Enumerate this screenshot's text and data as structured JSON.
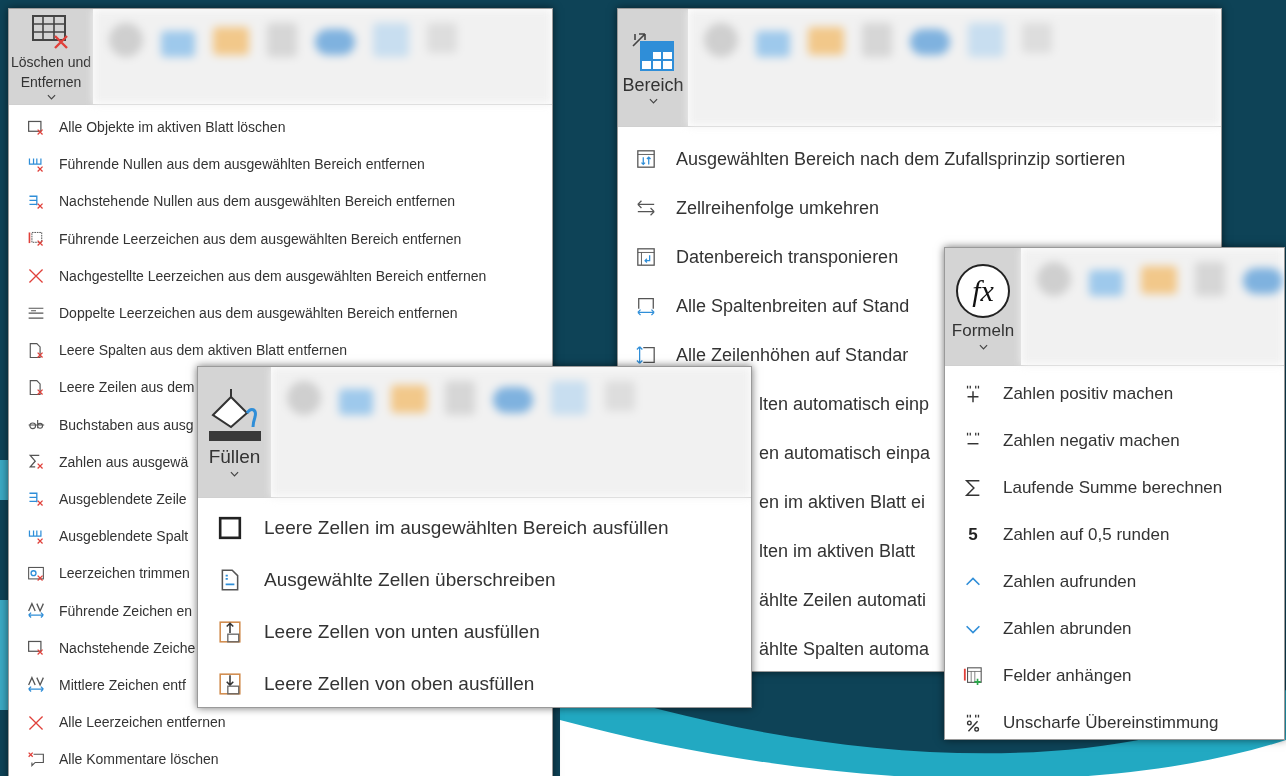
{
  "panels": [
    {
      "header": {
        "label": "Löschen und Entfernen",
        "expanded": true,
        "kind": "table-cross"
      },
      "items": [
        {
          "kind": "sheet-x",
          "label": "Alle Objekte im aktiven Blatt löschen"
        },
        {
          "kind": "columns-x",
          "label": "Führende Nullen aus dem ausgewählten Bereich entfernen"
        },
        {
          "kind": "rows-x",
          "label": "Nachstehende Nullen aus dem ausgewählten Bereich entfernen"
        },
        {
          "kind": "grid-x",
          "label": "Führende Leerzeichen aus dem ausgewählten Bereich entfernen"
        },
        {
          "kind": "cross",
          "label": "Nachgestellte Leerzeichen aus dem ausgewählten Bereich entfernen"
        },
        {
          "kind": "lines",
          "label": "Doppelte Leerzeichen aus dem ausgewählten Bereich entfernen"
        },
        {
          "kind": "doc-x",
          "label": "Leere Spalten aus dem aktiven Blatt entfernen"
        },
        {
          "kind": "doc-x",
          "label": "Leere Zeilen aus dem"
        },
        {
          "kind": "strike",
          "label": "Buchstaben aus ausg"
        },
        {
          "kind": "sigma-x",
          "label": "Zahlen aus ausgewä"
        },
        {
          "kind": "rows-x",
          "label": "Ausgeblendete Zeile"
        },
        {
          "kind": "columns-x",
          "label": "Ausgeblendete Spalt"
        },
        {
          "kind": "trim",
          "label": "Leerzeichen trimmen"
        },
        {
          "kind": "spacing",
          "label": "Führende Zeichen en"
        },
        {
          "kind": "sheet-x",
          "label": "Nachstehende Zeiche"
        },
        {
          "kind": "spacing",
          "label": "Mittlere Zeichen entf"
        },
        {
          "kind": "cross",
          "label": "Alle Leerzeichen entfernen"
        },
        {
          "kind": "comment-x",
          "label": "Alle Kommentare löschen"
        }
      ]
    },
    {
      "header": {
        "label": "Bereich",
        "expanded": true,
        "kind": "table-swap"
      },
      "items": [
        {
          "kind": "sort",
          "label": "Ausgewählten Bereich nach dem Zufallsprinzip sortieren"
        },
        {
          "kind": "swap",
          "label": "Zellreihenfolge umkehren"
        },
        {
          "kind": "transpose",
          "label": "Datenbereich transponieren"
        },
        {
          "kind": "col-width",
          "label": "Alle Spaltenbreiten auf Stand"
        },
        {
          "kind": "row-height",
          "label": "Alle Zeilenhöhen auf Standar"
        },
        {
          "kind": "partial",
          "label": "lten automatisch einp"
        },
        {
          "kind": "partial",
          "label": "en automatisch einpa"
        },
        {
          "kind": "partial",
          "label": "en im aktiven Blatt ei"
        },
        {
          "kind": "partial",
          "label": "lten im aktiven Blatt"
        },
        {
          "kind": "partial",
          "label": "ählte Zeilen automati"
        },
        {
          "kind": "partial",
          "label": "ählte Spalten automa"
        }
      ]
    },
    {
      "header": {
        "label": "Füllen",
        "expanded": true,
        "kind": "bucket"
      },
      "items": [
        {
          "kind": "square",
          "label": "Leere Zellen im ausgewählten Bereich ausfüllen"
        },
        {
          "kind": "doc",
          "label": "Ausgewählte Zellen überschreiben"
        },
        {
          "kind": "fill-up",
          "label": "Leere Zellen von unten ausfüllen"
        },
        {
          "kind": "fill-down",
          "label": "Leere Zellen von oben ausfüllen"
        }
      ]
    },
    {
      "header": {
        "label": "Formeln",
        "expanded": true,
        "kind": "fx",
        "glyph": "fx"
      },
      "items": [
        {
          "kind": "plus",
          "label": "Zahlen positiv machen"
        },
        {
          "kind": "minus",
          "label": "Zahlen negativ machen"
        },
        {
          "kind": "sigma",
          "label": "Laufende Summe berechnen"
        },
        {
          "kind": "glyph",
          "glyph": "5",
          "label": "Zahlen auf 0,5 runden"
        },
        {
          "kind": "caret-up",
          "label": "Zahlen aufrunden"
        },
        {
          "kind": "caret-down",
          "label": "Zahlen abrunden"
        },
        {
          "kind": "fields",
          "label": "Felder anhängen"
        },
        {
          "kind": "percent",
          "label": "Unscharfe Übereinstimmung"
        }
      ]
    }
  ]
}
